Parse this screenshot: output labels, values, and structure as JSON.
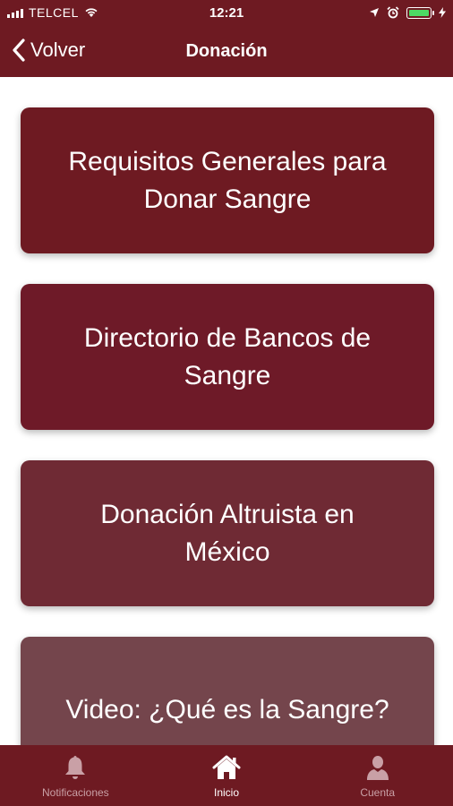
{
  "status_bar": {
    "carrier": "TELCEL",
    "time": "12:21"
  },
  "nav": {
    "back_label": "Volver",
    "title": "Donación"
  },
  "menu": [
    {
      "label": "Requisitos Generales para Donar Sangre",
      "color": "#6e1a22"
    },
    {
      "label": "Directorio de Bancos de Sangre",
      "color": "#6e1a28"
    },
    {
      "label": "Donación Altruista en México",
      "color": "#6f2a34"
    },
    {
      "label": "Video: ¿Qué es la Sangre?",
      "color": "#74454c"
    }
  ],
  "tabs": [
    {
      "label": "Notificaciones",
      "icon": "bell-icon",
      "active": false
    },
    {
      "label": "Inicio",
      "icon": "home-icon",
      "active": true
    },
    {
      "label": "Cuenta",
      "icon": "user-icon",
      "active": false
    }
  ],
  "colors": {
    "brand": "#6e1a22",
    "tab_inactive": "#c9a0a6",
    "tab_active": "#ffffff",
    "battery": "#4cd964"
  }
}
